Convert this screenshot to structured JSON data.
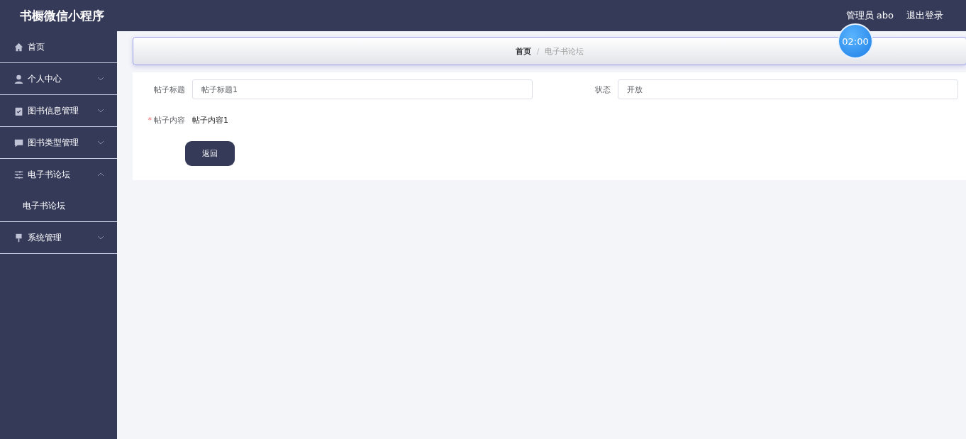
{
  "header": {
    "title": "书橱微信小程序",
    "user": "管理员 abo",
    "logout": "退出登录"
  },
  "timer": "02:00",
  "sidebar": {
    "items": [
      {
        "label": "首页"
      },
      {
        "label": "个人中心",
        "expanded": false
      },
      {
        "label": "图书信息管理",
        "expanded": false
      },
      {
        "label": "图书类型管理",
        "expanded": false
      },
      {
        "label": "电子书论坛",
        "expanded": true,
        "children": [
          {
            "label": "电子书论坛"
          }
        ]
      },
      {
        "label": "系统管理",
        "expanded": false
      }
    ]
  },
  "breadcrumb": [
    {
      "label": "首页",
      "selected": false
    },
    {
      "label": "电子书论坛",
      "selected": true
    }
  ],
  "breadcrumb_separator": "/",
  "form": {
    "fields": [
      {
        "label": "帖子标题",
        "value": "帖子标题1",
        "kind": "input",
        "required": false
      },
      {
        "label": "状态",
        "value": "开放",
        "kind": "input",
        "required": false
      },
      {
        "label": "帖子内容",
        "value": "帖子内容1",
        "kind": "text",
        "required": true
      }
    ],
    "required_mark": "*",
    "button": "返回"
  }
}
